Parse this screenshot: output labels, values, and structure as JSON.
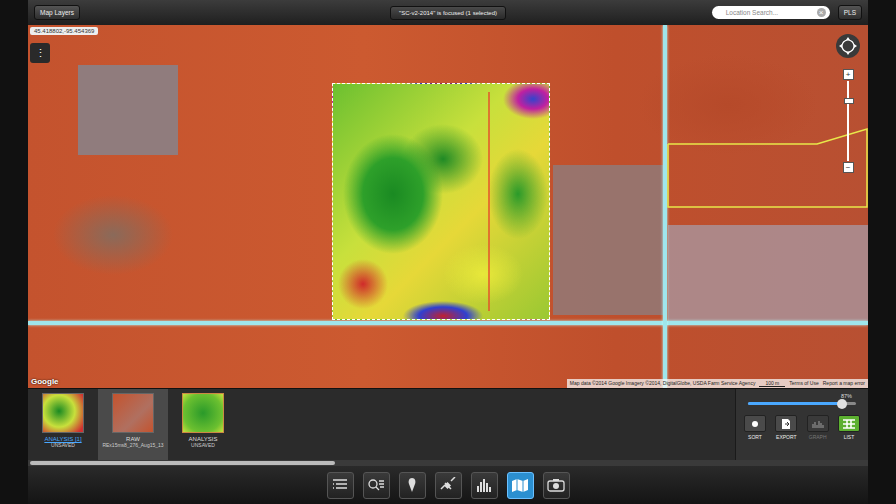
{
  "topbar": {
    "layers_button": "Map Layers",
    "focus_label": "\"SC-v2-2014\" is focused (1 selected)",
    "search": {
      "placeholder": "Location Search...",
      "clear": "×"
    },
    "pls_button": "PLS"
  },
  "map": {
    "coordinates": "45.418802,-95.454369",
    "menu": "⋮",
    "logo": "Google",
    "attribution": "Map data ©2014 Google Imagery ©2014, DigitalGlobe, USDA Farm Service Agency",
    "scale": "100 m",
    "terms": "Terms of Use",
    "report": "Report a map error",
    "zoom": {
      "plus": "+",
      "minus": "−",
      "level": 0.75
    }
  },
  "thumbnails": [
    {
      "kind": "analysis",
      "title": "ANALYSIS [1]",
      "subtitle": "UNSAVED",
      "selected": true
    },
    {
      "kind": "raw",
      "title": "RAW",
      "subtitle": "REx15ms8_276_Aug15_13",
      "selected": false
    },
    {
      "kind": "analysis-green",
      "title": "ANALYSIS",
      "subtitle": "UNSAVED",
      "selected": false
    }
  ],
  "opacity": {
    "reading": "87%",
    "level": 0.87
  },
  "actions": [
    {
      "kind": "sort",
      "label": "SORT",
      "disabled": false,
      "selected": false
    },
    {
      "kind": "export",
      "label": "EXPORT",
      "disabled": false,
      "selected": false
    },
    {
      "kind": "graph",
      "label": "GRAPH",
      "disabled": true,
      "selected": false
    },
    {
      "kind": "list",
      "label": "LIST",
      "disabled": false,
      "selected": true
    }
  ],
  "toolbar": [
    {
      "kind": "list",
      "selected": false
    },
    {
      "kind": "search",
      "selected": false
    },
    {
      "kind": "pin",
      "selected": false
    },
    {
      "kind": "satellite",
      "selected": false
    },
    {
      "kind": "histogram",
      "selected": false
    },
    {
      "kind": "map",
      "selected": true
    },
    {
      "kind": "camera",
      "selected": false
    }
  ]
}
